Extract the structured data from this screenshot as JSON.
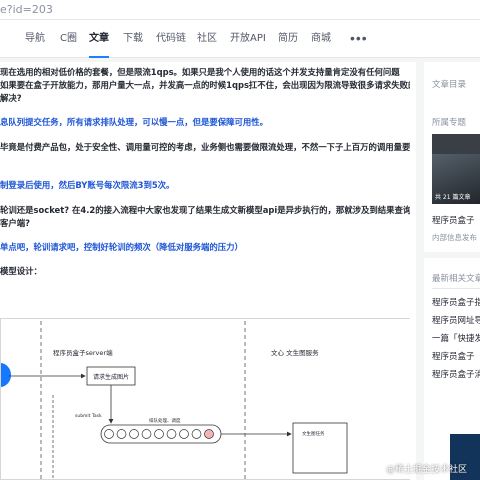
{
  "browser": {
    "url_fragment": "e?id=203"
  },
  "nav": {
    "items": [
      "导航",
      "C圈",
      "文章",
      "下载",
      "代码链",
      "社区",
      "开放API",
      "简历",
      "商城"
    ],
    "active": "文章",
    "more_label": "•••"
  },
  "article": {
    "paragraphs": [
      {
        "text": "现在选用的相对低价格的套餐，但是限流1qps。如果只是我个人使用的话这个并发支持量肯定没有任何问题",
        "style": "normal"
      },
      {
        "text": "如果要在盒子开放能力，那用户量大一点，并发高一点的时候1qps扛不住，会出现因为限流导致很多请求失败的",
        "style": "normal"
      },
      {
        "text": "解决?",
        "style": "normal"
      },
      {
        "text": "息队列提交任务，所有请求排队处理，可以慢一点，但是要保障可用性。",
        "style": "blue"
      },
      {
        "text": "毕竟是付费产品包，处于安全性、调用量可控的考虑，业务侧也需要做限流处理，不然一下子上百万的调用量要",
        "style": "normal"
      },
      {
        "text": "制登录后使用，然后BY账号每次限流3到5次。",
        "style": "blue"
      },
      {
        "text": "轮训还是socket? 在4.2的接入流程中大家也发现了结果生成文新模型api是异步执行的，那就涉及到结果查询怎",
        "style": "normal"
      },
      {
        "text": "客户端?",
        "style": "normal"
      },
      {
        "text": "单点吧，轮训请求吧，控制好轮训的频次（降低对服务端的压力）",
        "style": "blue"
      },
      {
        "text": "模型设计：",
        "style": "normal"
      }
    ],
    "diagram": {
      "lane_1_title": "程序员盒子server端",
      "lane_2_title": "文心 文生图服务",
      "box_request": "请求生成图片",
      "arrow_submit": "submit Task",
      "queue_caption": "排队处理、调度",
      "box_task": "文生图任务",
      "queue_slots": 9,
      "queue_highlight_index": 8
    }
  },
  "sidebar": {
    "toc_title": "文章目录",
    "column_title": "所属专题",
    "column_badge": "共 21 篇文章",
    "column_name": "程序员盒子",
    "column_meta": "内部信息发布",
    "related_title": "最新相关文章",
    "related_items": [
      "程序员盒子指",
      "程序员网址导",
      "一篇「快捷发",
      "程序员盒子",
      "程序员盒子消"
    ]
  },
  "watermark": "@稀土掘金技术社区",
  "colors": {
    "accent": "#1e80ff",
    "highlight_text": "#1e56d6",
    "lane_blue": "#1677ff"
  }
}
